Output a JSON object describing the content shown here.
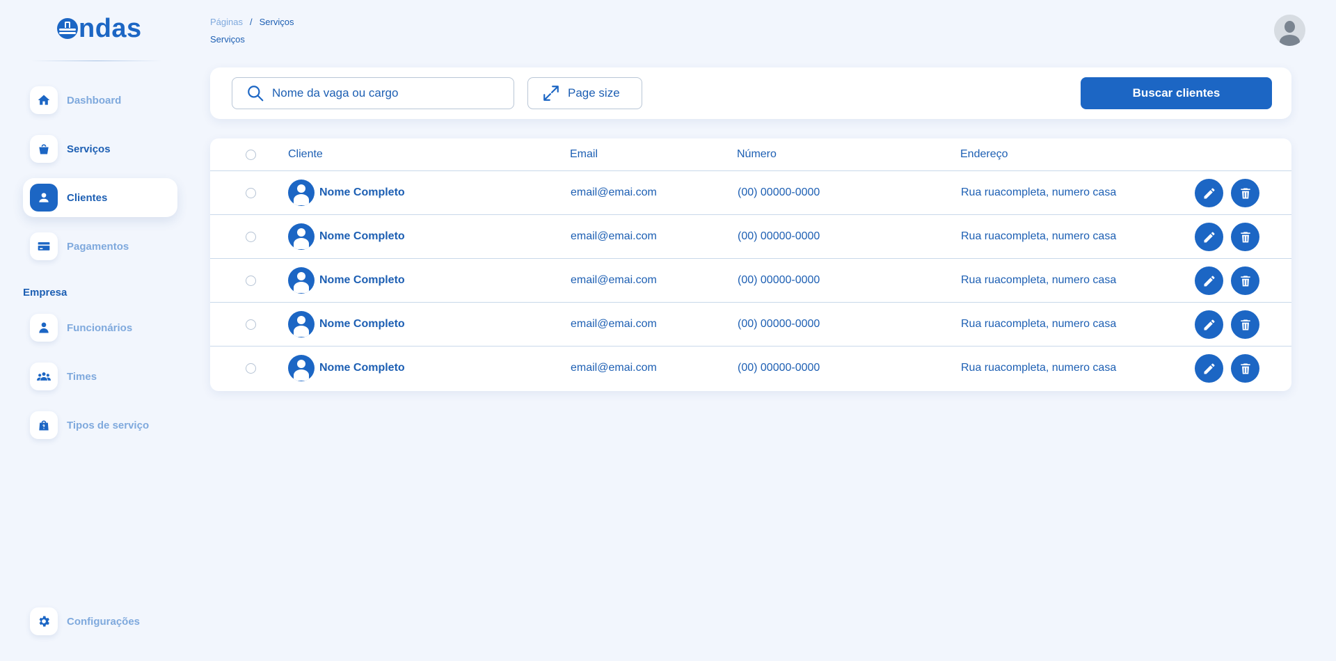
{
  "brand": {
    "logo_text": "ndas",
    "color": "#1c66c4"
  },
  "sidebar": {
    "items": [
      {
        "label": "Dashboard",
        "icon": "home-icon"
      },
      {
        "label": "Serviços",
        "icon": "basket-icon"
      },
      {
        "label": "Clientes",
        "icon": "person-icon",
        "active": true
      },
      {
        "label": "Pagamentos",
        "icon": "credit-card-icon"
      }
    ],
    "section_title": "Empresa",
    "company_items": [
      {
        "label": "Funcionários",
        "icon": "employee-icon"
      },
      {
        "label": "Times",
        "icon": "team-icon"
      },
      {
        "label": "Tipos de serviço",
        "icon": "bag-icon"
      }
    ],
    "settings": {
      "label": "Configurações",
      "icon": "gear-icon"
    }
  },
  "header": {
    "breadcrumb_root": "Páginas",
    "breadcrumb_separator": "/",
    "breadcrumb_current": "Serviços",
    "page_title": "Serviços"
  },
  "toolbar": {
    "search_placeholder": "Nome da vaga ou cargo",
    "page_size_label": "Page size",
    "search_button_label": "Buscar clientes"
  },
  "table": {
    "columns": [
      "Cliente",
      "Email",
      "Número",
      "Endereço"
    ],
    "rows": [
      {
        "name": "Nome Completo",
        "email": "email@emai.com",
        "phone": "(00) 00000-0000",
        "address": "Rua ruacompleta, numero casa"
      },
      {
        "name": "Nome Completo",
        "email": "email@emai.com",
        "phone": "(00) 00000-0000",
        "address": "Rua ruacompleta, numero casa"
      },
      {
        "name": "Nome Completo",
        "email": "email@emai.com",
        "phone": "(00) 00000-0000",
        "address": "Rua ruacompleta, numero casa"
      },
      {
        "name": "Nome Completo",
        "email": "email@emai.com",
        "phone": "(00) 00000-0000",
        "address": "Rua ruacompleta, numero casa"
      },
      {
        "name": "Nome Completo",
        "email": "email@emai.com",
        "phone": "(00) 00000-0000",
        "address": "Rua ruacompleta, numero casa"
      }
    ]
  },
  "colors": {
    "primary": "#1c66c4",
    "background": "#f2f6fd",
    "muted_text": "#7fa9dd",
    "text": "#1d5fb3"
  }
}
